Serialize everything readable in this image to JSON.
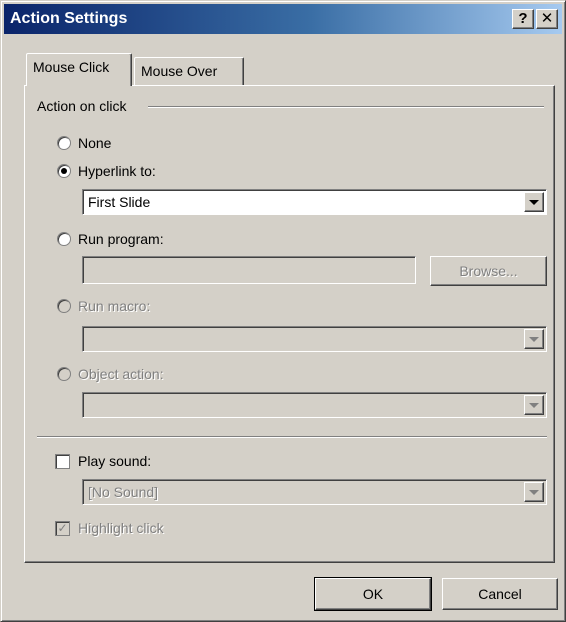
{
  "window": {
    "title": "Action Settings",
    "help_label": "?",
    "close_label": "✕"
  },
  "tabs": [
    {
      "label": "Mouse Click",
      "active": true
    },
    {
      "label": "Mouse Over",
      "active": false
    }
  ],
  "group": {
    "title": "Action on click",
    "options": {
      "none": "None",
      "hyperlink": "Hyperlink to:",
      "run_program": "Run program:",
      "run_macro": "Run macro:",
      "object_action": "Object action:"
    },
    "selected": "hyperlink",
    "hyperlink_value": "First Slide",
    "browse_label": "Browse..."
  },
  "sound": {
    "play_label": "Play sound:",
    "play_checked": false,
    "sound_value": "[No Sound]",
    "highlight_label": "Highlight click",
    "highlight_checked": true
  },
  "buttons": {
    "ok": "OK",
    "cancel": "Cancel"
  },
  "icons": {
    "dropdown": "chevron-down-icon",
    "check": "✓"
  },
  "colors": {
    "face": "#d4d0c8",
    "title_start": "#0a246a",
    "title_end": "#a6caf0"
  }
}
